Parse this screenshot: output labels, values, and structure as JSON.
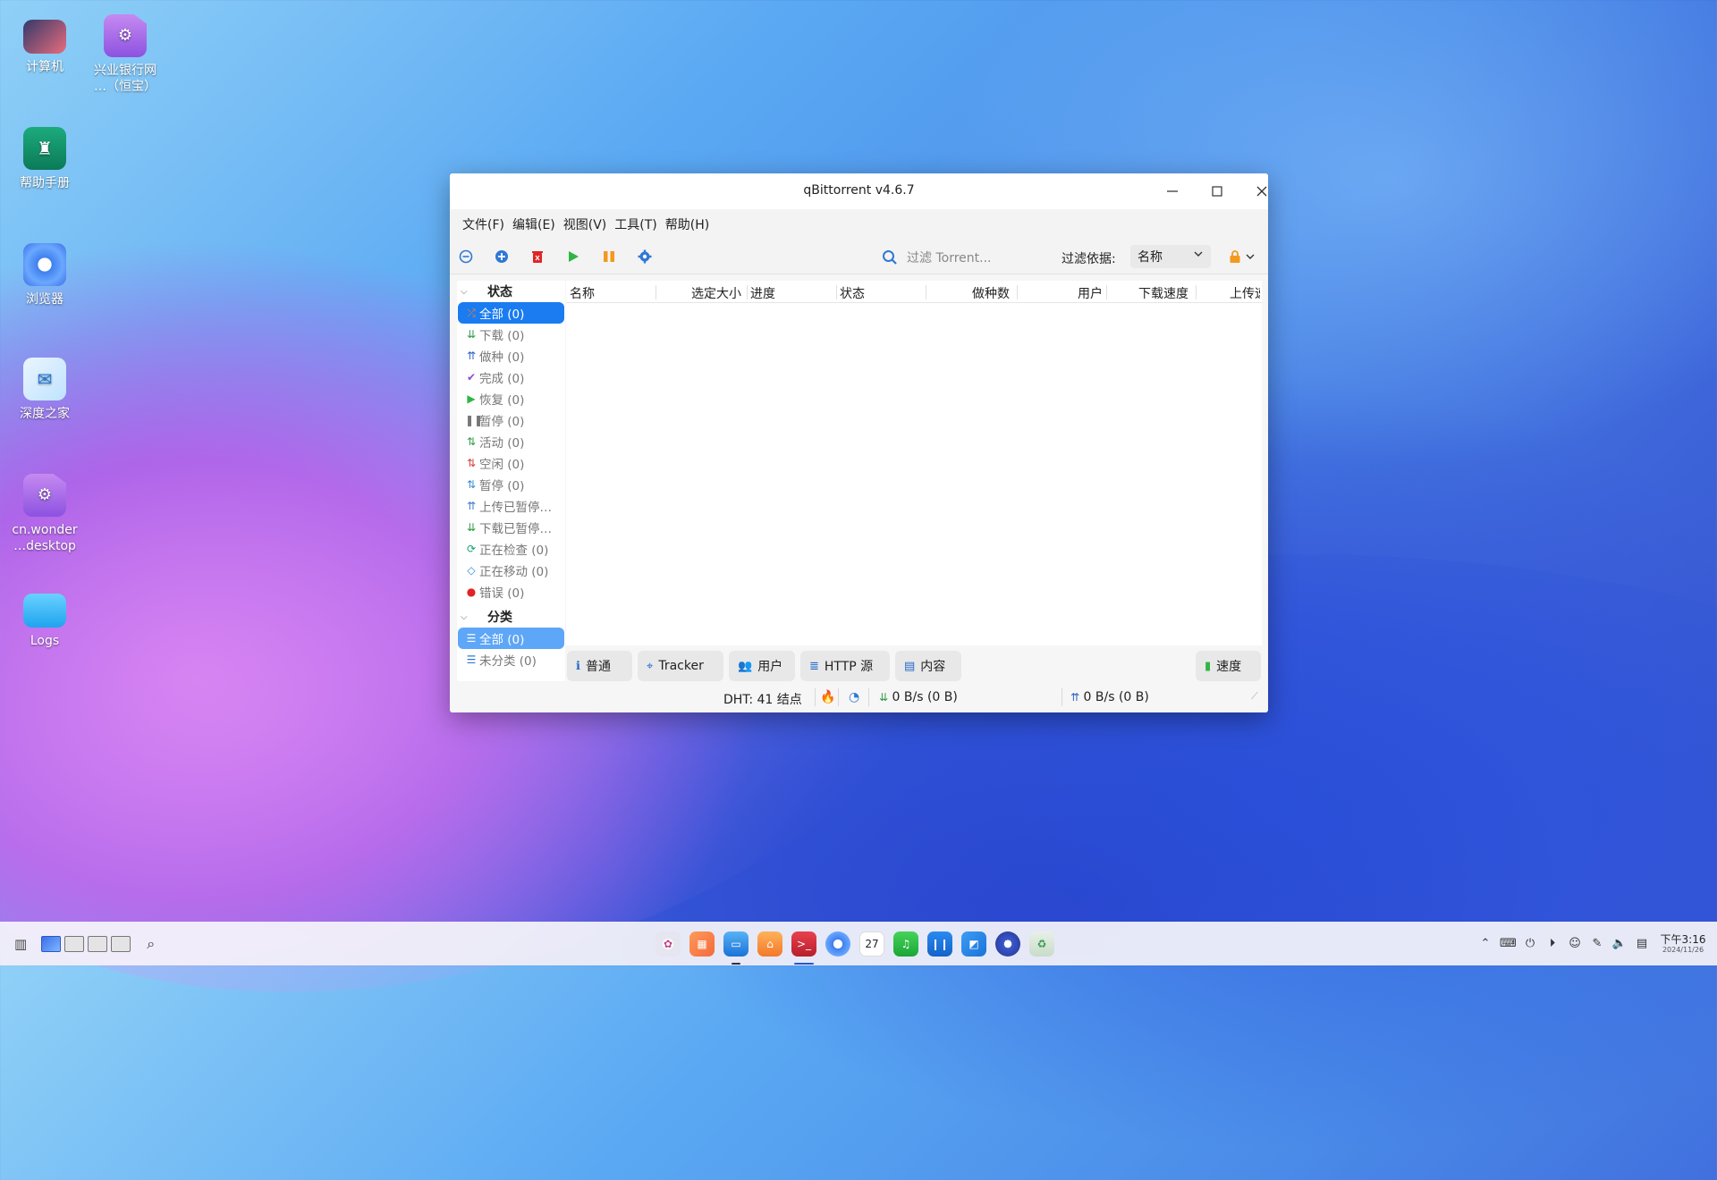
{
  "desktop": {
    "icons": [
      {
        "label": "计算机"
      },
      {
        "label": "兴业银行网\n…（恒宝）"
      },
      {
        "label": "帮助手册"
      },
      {
        "label": "浏览器"
      },
      {
        "label": "深度之家"
      },
      {
        "label": "cn.wonder\n…desktop"
      },
      {
        "label": "Logs"
      }
    ]
  },
  "window": {
    "title": "qBittorrent v4.6.7",
    "menu": [
      "文件(F)",
      "编辑(E)",
      "视图(V)",
      "工具(T)",
      "帮助(H)"
    ],
    "toolbar": {
      "search_placeholder": "过滤 Torrent...",
      "filter_label": "过滤依据:",
      "filter_value": "名称"
    },
    "sidebar": {
      "status_header": "状态",
      "status_items": [
        {
          "label": "全部 (0)",
          "icon": "all-icon",
          "color": "#e8823a"
        },
        {
          "label": "下载 (0)",
          "icon": "download-icon",
          "color": "#2e9a44"
        },
        {
          "label": "做种 (0)",
          "icon": "seed-icon",
          "color": "#2e5fc4"
        },
        {
          "label": "完成 (0)",
          "icon": "check-icon",
          "color": "#8a4bd0"
        },
        {
          "label": "恢复 (0)",
          "icon": "play-icon",
          "color": "#2fb544"
        },
        {
          "label": "暂停 (0)",
          "icon": "pause-icon",
          "color": "#777777"
        },
        {
          "label": "活动 (0)",
          "icon": "active-icon",
          "color": "#2e9a44"
        },
        {
          "label": "空闲 (0)",
          "icon": "idle-icon",
          "color": "#d43a3a"
        },
        {
          "label": "暂停 (0)",
          "icon": "stalled-icon",
          "color": "#3a8ad0"
        },
        {
          "label": "上传已暂停…",
          "icon": "upload-stalled-icon",
          "color": "#3a7ad0"
        },
        {
          "label": "下载已暂停…",
          "icon": "download-stalled-icon",
          "color": "#2e9a44"
        },
        {
          "label": "正在检查 (0)",
          "icon": "checking-icon",
          "color": "#17a07a"
        },
        {
          "label": "正在移动 (0)",
          "icon": "moving-icon",
          "color": "#2e88d8"
        },
        {
          "label": "错误 (0)",
          "icon": "error-icon",
          "color": "#e02424"
        }
      ],
      "category_header": "分类",
      "category_items": [
        {
          "label": "全部 (0)"
        },
        {
          "label": "未分类 (0)"
        }
      ]
    },
    "table": {
      "columns": [
        "名称",
        "选定大小",
        "进度",
        "状态",
        "做种数",
        "用户",
        "下载速度",
        "上传速"
      ]
    },
    "bottom_tabs": [
      {
        "label": "普通",
        "icon": "info-icon"
      },
      {
        "label": "Tracker",
        "icon": "location-icon"
      },
      {
        "label": "用户",
        "icon": "users-icon"
      },
      {
        "label": "HTTP 源",
        "icon": "database-icon"
      },
      {
        "label": "内容",
        "icon": "content-icon"
      }
    ],
    "speed_button": "速度",
    "statusbar": {
      "dht": "DHT:  41 结点",
      "download": "0 B/s (0 B)",
      "upload": "0 B/s (0 B)"
    }
  },
  "taskbar": {
    "clock_time": "下午3:16",
    "clock_date": "2024/11/26",
    "calendar_day": "27"
  }
}
